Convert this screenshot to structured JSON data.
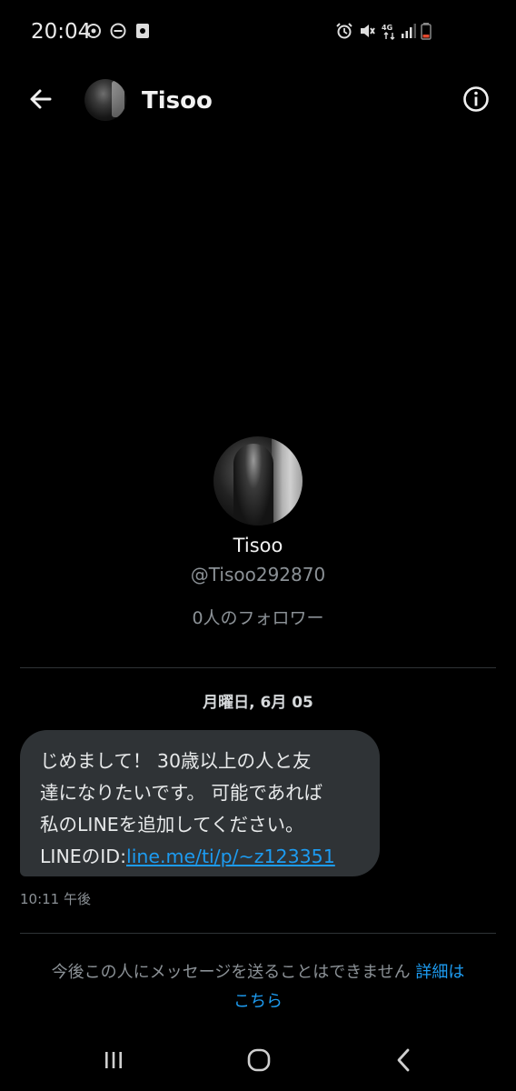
{
  "status_bar": {
    "time": "20:04",
    "icons": [
      "sync-icon",
      "dnd-icon",
      "photo-icon",
      "alarm-icon",
      "mute-icon",
      "4g-icon",
      "signal-icon",
      "battery-icon"
    ]
  },
  "header": {
    "title": "Tisoo",
    "back_icon": "arrow-left-icon",
    "info_icon": "info-icon"
  },
  "profile": {
    "name": "Tisoo",
    "handle": "@Tisoo292870",
    "followers": "0人のフォロワー"
  },
  "conversation": {
    "date": "月曜日, 6月 05",
    "message": {
      "line1": "じめまして！ 30歳以上の人と友",
      "line2": "達になりたいです。 可能であれば",
      "line3": "私のLINEを追加してください。",
      "line4_prefix": "LINEのID:",
      "link": "line.me/ti/p/~z123351",
      "time": "10:11 午後"
    }
  },
  "notice": {
    "text": "今後この人にメッセージを送ることはできません",
    "link_part1": "詳細は",
    "link_part2": "こちら"
  },
  "colors": {
    "background": "#000000",
    "bubble": "#2f3336",
    "link": "#1d9bf0",
    "muted_text": "#8b9196"
  }
}
